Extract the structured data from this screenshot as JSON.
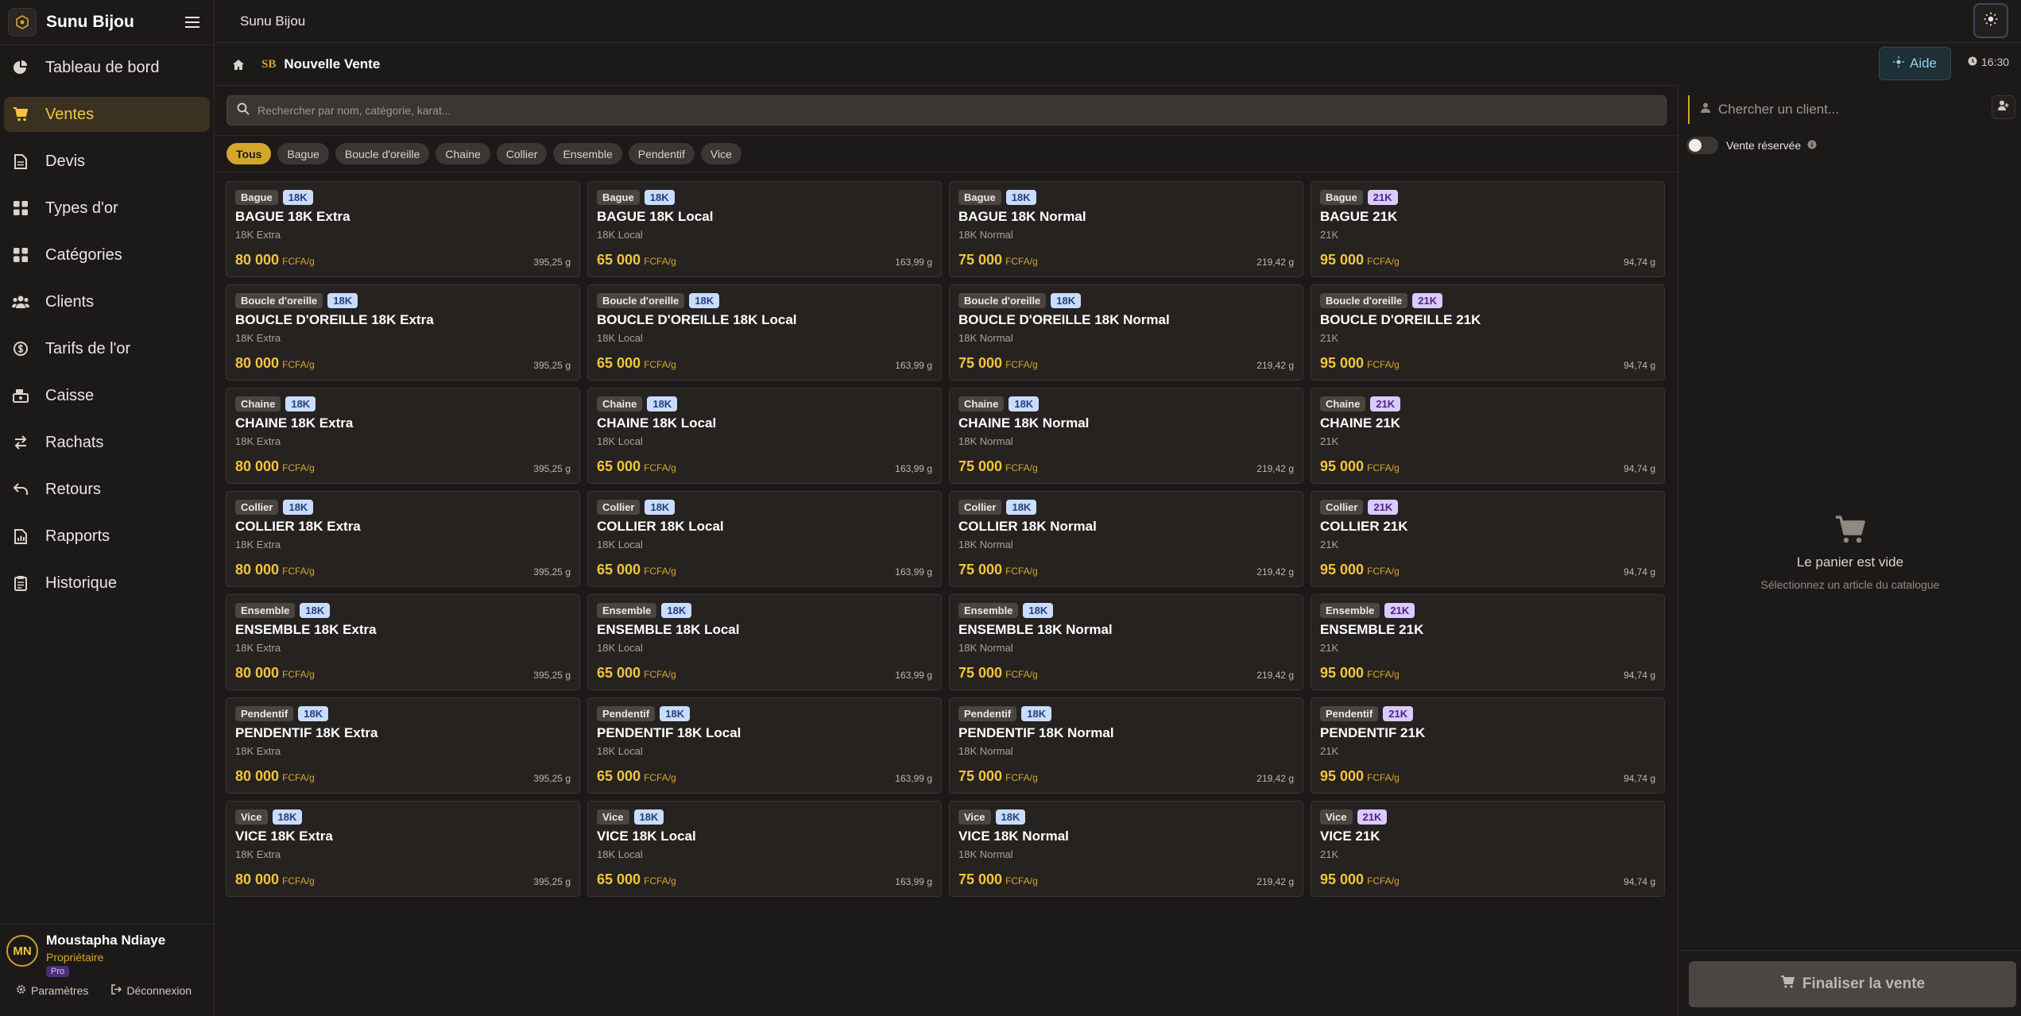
{
  "app": {
    "name": "Sunu Bijou",
    "logo_icon": "gem-logo-icon"
  },
  "sidebar": {
    "items": [
      {
        "label": "Tableau de bord",
        "icon": "pie-chart-icon",
        "active": false
      },
      {
        "label": "Ventes",
        "icon": "cart-icon",
        "active": true
      },
      {
        "label": "Devis",
        "icon": "document-icon",
        "active": false
      },
      {
        "label": "Types d'or",
        "icon": "grid-icon",
        "active": false
      },
      {
        "label": "Catégories",
        "icon": "grid-icon",
        "active": false
      },
      {
        "label": "Clients",
        "icon": "users-icon",
        "active": false
      },
      {
        "label": "Tarifs de l'or",
        "icon": "dollar-icon",
        "active": false
      },
      {
        "label": "Caisse",
        "icon": "cash-register-icon",
        "active": false
      },
      {
        "label": "Rachats",
        "icon": "swap-icon",
        "active": false
      },
      {
        "label": "Retours",
        "icon": "undo-icon",
        "active": false
      },
      {
        "label": "Rapports",
        "icon": "report-icon",
        "active": false
      },
      {
        "label": "Historique",
        "icon": "history-icon",
        "active": false
      }
    ]
  },
  "user": {
    "initials": "MN",
    "name": "Moustapha Ndiaye",
    "role": "Propriétaire",
    "plan": "Pro",
    "settings_label": "Paramètres",
    "logout_label": "Déconnexion"
  },
  "topbar": {
    "title": "Sunu Bijou"
  },
  "header": {
    "mark": "SB",
    "title": "Nouvelle Vente",
    "help_label": "Aide",
    "time": "16:30"
  },
  "search": {
    "placeholder": "Rechercher par nom, catégorie, karat..."
  },
  "filters": [
    "Tous",
    "Bague",
    "Boucle d'oreille",
    "Chaine",
    "Collier",
    "Ensemble",
    "Pendentif",
    "Vice"
  ],
  "products": [
    {
      "category": "Bague",
      "karat": "18K",
      "name": "BAGUE 18K Extra",
      "type": "18K Extra",
      "price": "80 000",
      "unit": "FCFA/g",
      "weight": "395,25 g"
    },
    {
      "category": "Bague",
      "karat": "18K",
      "name": "BAGUE 18K Local",
      "type": "18K Local",
      "price": "65 000",
      "unit": "FCFA/g",
      "weight": "163,99 g"
    },
    {
      "category": "Bague",
      "karat": "18K",
      "name": "BAGUE 18K Normal",
      "type": "18K Normal",
      "price": "75 000",
      "unit": "FCFA/g",
      "weight": "219,42 g"
    },
    {
      "category": "Bague",
      "karat": "21K",
      "name": "BAGUE 21K",
      "type": "21K",
      "price": "95 000",
      "unit": "FCFA/g",
      "weight": "94,74 g"
    },
    {
      "category": "Boucle d'oreille",
      "karat": "18K",
      "name": "BOUCLE D'OREILLE 18K Extra",
      "type": "18K Extra",
      "price": "80 000",
      "unit": "FCFA/g",
      "weight": "395,25 g"
    },
    {
      "category": "Boucle d'oreille",
      "karat": "18K",
      "name": "BOUCLE D'OREILLE 18K Local",
      "type": "18K Local",
      "price": "65 000",
      "unit": "FCFA/g",
      "weight": "163,99 g"
    },
    {
      "category": "Boucle d'oreille",
      "karat": "18K",
      "name": "BOUCLE D'OREILLE 18K Normal",
      "type": "18K Normal",
      "price": "75 000",
      "unit": "FCFA/g",
      "weight": "219,42 g"
    },
    {
      "category": "Boucle d'oreille",
      "karat": "21K",
      "name": "BOUCLE D'OREILLE 21K",
      "type": "21K",
      "price": "95 000",
      "unit": "FCFA/g",
      "weight": "94,74 g"
    },
    {
      "category": "Chaine",
      "karat": "18K",
      "name": "CHAINE 18K Extra",
      "type": "18K Extra",
      "price": "80 000",
      "unit": "FCFA/g",
      "weight": "395,25 g"
    },
    {
      "category": "Chaine",
      "karat": "18K",
      "name": "CHAINE 18K Local",
      "type": "18K Local",
      "price": "65 000",
      "unit": "FCFA/g",
      "weight": "163,99 g"
    },
    {
      "category": "Chaine",
      "karat": "18K",
      "name": "CHAINE 18K Normal",
      "type": "18K Normal",
      "price": "75 000",
      "unit": "FCFA/g",
      "weight": "219,42 g"
    },
    {
      "category": "Chaine",
      "karat": "21K",
      "name": "CHAINE 21K",
      "type": "21K",
      "price": "95 000",
      "unit": "FCFA/g",
      "weight": "94,74 g"
    },
    {
      "category": "Collier",
      "karat": "18K",
      "name": "COLLIER 18K Extra",
      "type": "18K Extra",
      "price": "80 000",
      "unit": "FCFA/g",
      "weight": "395,25 g"
    },
    {
      "category": "Collier",
      "karat": "18K",
      "name": "COLLIER 18K Local",
      "type": "18K Local",
      "price": "65 000",
      "unit": "FCFA/g",
      "weight": "163,99 g"
    },
    {
      "category": "Collier",
      "karat": "18K",
      "name": "COLLIER 18K Normal",
      "type": "18K Normal",
      "price": "75 000",
      "unit": "FCFA/g",
      "weight": "219,42 g"
    },
    {
      "category": "Collier",
      "karat": "21K",
      "name": "COLLIER 21K",
      "type": "21K",
      "price": "95 000",
      "unit": "FCFA/g",
      "weight": "94,74 g"
    },
    {
      "category": "Ensemble",
      "karat": "18K",
      "name": "ENSEMBLE 18K Extra",
      "type": "18K Extra",
      "price": "80 000",
      "unit": "FCFA/g",
      "weight": "395,25 g"
    },
    {
      "category": "Ensemble",
      "karat": "18K",
      "name": "ENSEMBLE 18K Local",
      "type": "18K Local",
      "price": "65 000",
      "unit": "FCFA/g",
      "weight": "163,99 g"
    },
    {
      "category": "Ensemble",
      "karat": "18K",
      "name": "ENSEMBLE 18K Normal",
      "type": "18K Normal",
      "price": "75 000",
      "unit": "FCFA/g",
      "weight": "219,42 g"
    },
    {
      "category": "Ensemble",
      "karat": "21K",
      "name": "ENSEMBLE 21K",
      "type": "21K",
      "price": "95 000",
      "unit": "FCFA/g",
      "weight": "94,74 g"
    },
    {
      "category": "Pendentif",
      "karat": "18K",
      "name": "PENDENTIF 18K Extra",
      "type": "18K Extra",
      "price": "80 000",
      "unit": "FCFA/g",
      "weight": "395,25 g"
    },
    {
      "category": "Pendentif",
      "karat": "18K",
      "name": "PENDENTIF 18K Local",
      "type": "18K Local",
      "price": "65 000",
      "unit": "FCFA/g",
      "weight": "163,99 g"
    },
    {
      "category": "Pendentif",
      "karat": "18K",
      "name": "PENDENTIF 18K Normal",
      "type": "18K Normal",
      "price": "75 000",
      "unit": "FCFA/g",
      "weight": "219,42 g"
    },
    {
      "category": "Pendentif",
      "karat": "21K",
      "name": "PENDENTIF 21K",
      "type": "21K",
      "price": "95 000",
      "unit": "FCFA/g",
      "weight": "94,74 g"
    },
    {
      "category": "Vice",
      "karat": "18K",
      "name": "VICE 18K Extra",
      "type": "18K Extra",
      "price": "80 000",
      "unit": "FCFA/g",
      "weight": "395,25 g"
    },
    {
      "category": "Vice",
      "karat": "18K",
      "name": "VICE 18K Local",
      "type": "18K Local",
      "price": "65 000",
      "unit": "FCFA/g",
      "weight": "163,99 g"
    },
    {
      "category": "Vice",
      "karat": "18K",
      "name": "VICE 18K Normal",
      "type": "18K Normal",
      "price": "75 000",
      "unit": "FCFA/g",
      "weight": "219,42 g"
    },
    {
      "category": "Vice",
      "karat": "21K",
      "name": "VICE 21K",
      "type": "21K",
      "price": "95 000",
      "unit": "FCFA/g",
      "weight": "94,74 g"
    }
  ],
  "cart": {
    "client_placeholder": "Chercher un client...",
    "reserved_label": "Vente réservée",
    "empty_title": "Le panier est vide",
    "empty_subtitle": "Sélectionnez un article du catalogue",
    "finalize_label": "Finaliser la vente"
  },
  "colors": {
    "accent": "#d4a72c",
    "background": "#1c1a19",
    "card": "#252220"
  }
}
